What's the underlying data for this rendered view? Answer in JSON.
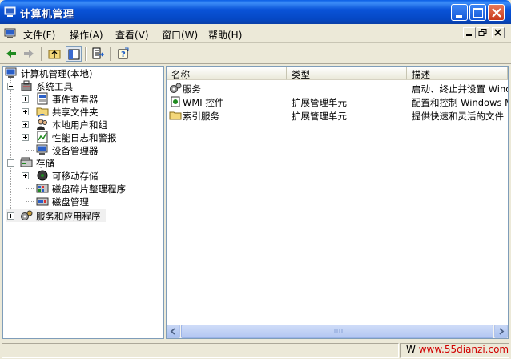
{
  "window": {
    "title": "计算机管理",
    "accent": "#0a53d8"
  },
  "menubar": {
    "items": [
      {
        "label": "文件(F)"
      },
      {
        "label": "操作(A)"
      },
      {
        "label": "查看(V)"
      },
      {
        "label": "窗口(W)"
      },
      {
        "label": "帮助(H)"
      }
    ]
  },
  "toolbar": {
    "buttons": [
      "back-icon",
      "forward-icon",
      "up-folder-icon",
      "show-tree-icon",
      "export-list-icon",
      "help-icon"
    ]
  },
  "tree": {
    "root": "计算机管理(本地)",
    "items": [
      {
        "label": "系统工具",
        "icon": "toolbox-icon"
      },
      {
        "label": "事件查看器",
        "icon": "event-viewer-icon"
      },
      {
        "label": "共享文件夹",
        "icon": "shared-folder-icon"
      },
      {
        "label": "本地用户和组",
        "icon": "users-icon"
      },
      {
        "label": "性能日志和警报",
        "icon": "performance-icon"
      },
      {
        "label": "设备管理器",
        "icon": "device-manager-icon"
      },
      {
        "label": "存储",
        "icon": "storage-icon"
      },
      {
        "label": "可移动存储",
        "icon": "removable-storage-icon"
      },
      {
        "label": "磁盘碎片整理程序",
        "icon": "defrag-icon"
      },
      {
        "label": "磁盘管理",
        "icon": "disk-management-icon"
      },
      {
        "label": "服务和应用程序",
        "icon": "services-apps-icon"
      }
    ]
  },
  "list": {
    "columns": [
      "名称",
      "类型",
      "描述"
    ],
    "rows": [
      {
        "name": "服务",
        "type": "",
        "desc": "启动、终止并设置 Windows",
        "icon": "services-gear-icon"
      },
      {
        "name": "WMI 控件",
        "type": "扩展管理单元",
        "desc": "配置和控制 Windows Man",
        "icon": "wmi-icon"
      },
      {
        "name": "索引服务",
        "type": "扩展管理单元",
        "desc": "提供快速和灵活的文件",
        "icon": "folder-icon"
      }
    ]
  },
  "statusbar": {
    "watermark_prefix": "W",
    "watermark_site": "www.55dianzi.com"
  }
}
